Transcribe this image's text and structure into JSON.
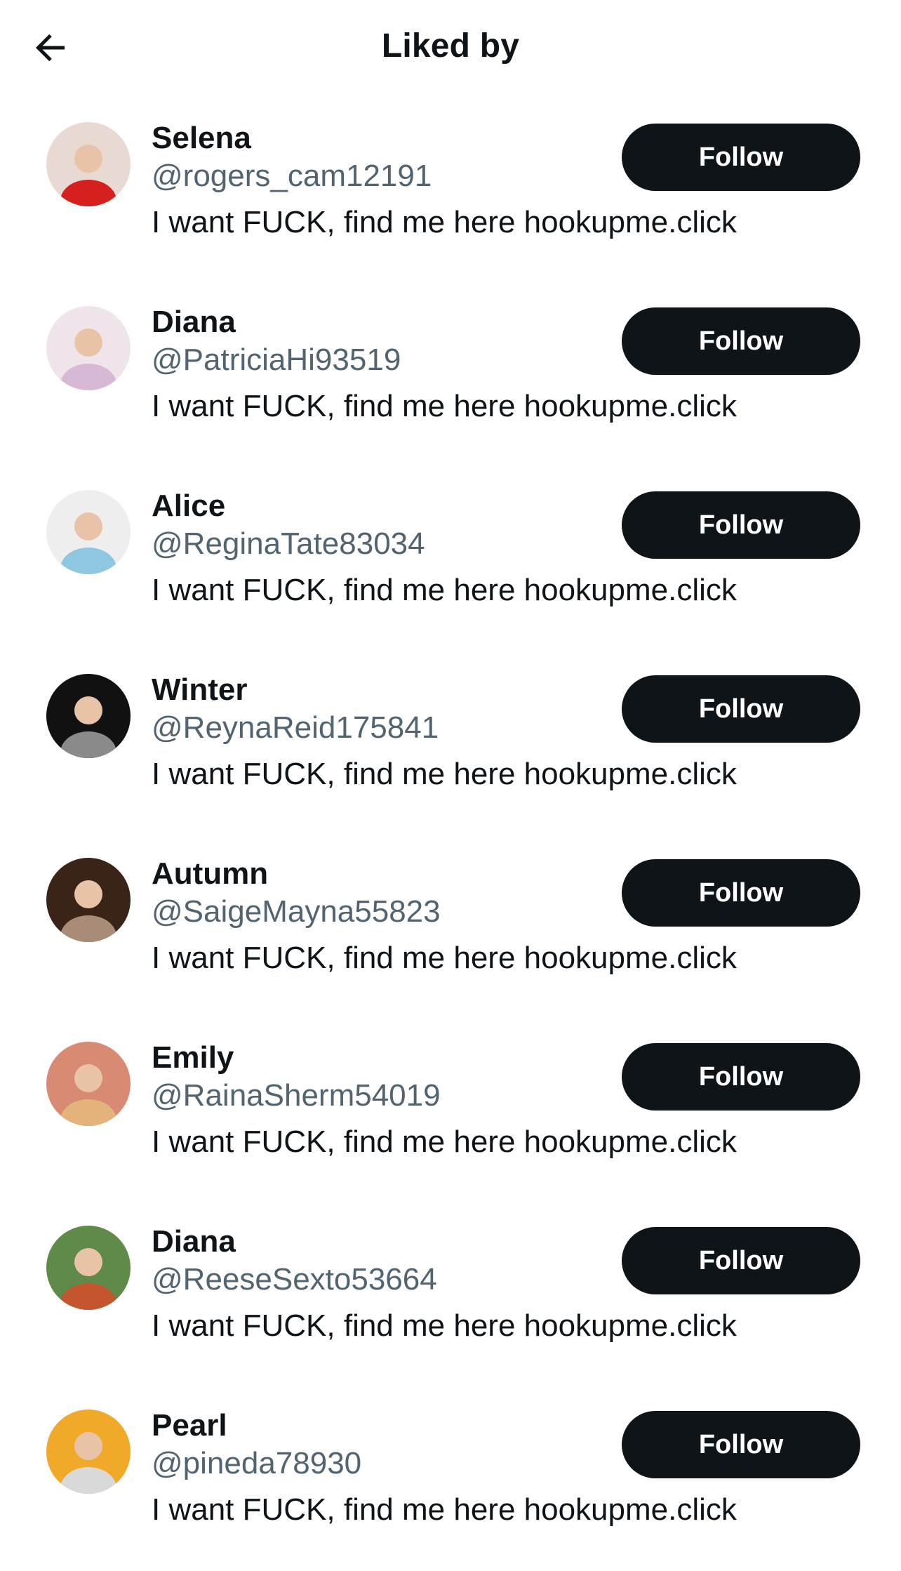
{
  "header": {
    "title": "Liked by",
    "back_icon": "arrow-left-icon"
  },
  "users": [
    {
      "name": "Selena",
      "handle": "@rogers_cam12191",
      "bio": "I want FUCK, find me here hookupme.click",
      "follow_label": "Follow",
      "avatar_color": "#e8d9d2",
      "avatar_accent": "#d62020"
    },
    {
      "name": "Diana",
      "handle": "@PatriciaHi93519",
      "bio": "I want FUCK, find me here hookupme.click",
      "follow_label": "Follow",
      "avatar_color": "#efe4ea",
      "avatar_accent": "#d7b9d6"
    },
    {
      "name": "Alice",
      "handle": "@ReginaTate83034",
      "bio": "I want FUCK, find me here hookupme.click",
      "follow_label": "Follow",
      "avatar_color": "#eeeeee",
      "avatar_accent": "#8fc7e3"
    },
    {
      "name": "Winter",
      "handle": "@ReynaReid175841",
      "bio": "I want FUCK, find me here hookupme.click",
      "follow_label": "Follow",
      "avatar_color": "#111111",
      "avatar_accent": "#8a8a8a"
    },
    {
      "name": "Autumn",
      "handle": "@SaigeMayna55823",
      "bio": "I want FUCK, find me here hookupme.click",
      "follow_label": "Follow",
      "avatar_color": "#3a2418",
      "avatar_accent": "#a98c78"
    },
    {
      "name": "Emily",
      "handle": "@RainaSherm54019",
      "bio": "I want FUCK, find me here hookupme.click",
      "follow_label": "Follow",
      "avatar_color": "#d88a73",
      "avatar_accent": "#e4b27b"
    },
    {
      "name": "Diana",
      "handle": "@ReeseSexto53664",
      "bio": "I want FUCK, find me here hookupme.click",
      "follow_label": "Follow",
      "avatar_color": "#5f8a4a",
      "avatar_accent": "#c4552f"
    },
    {
      "name": "Pearl",
      "handle": "@pineda78930",
      "bio": "I want FUCK, find me here hookupme.click",
      "follow_label": "Follow",
      "avatar_color": "#f0a928",
      "avatar_accent": "#d9d9d9"
    }
  ]
}
